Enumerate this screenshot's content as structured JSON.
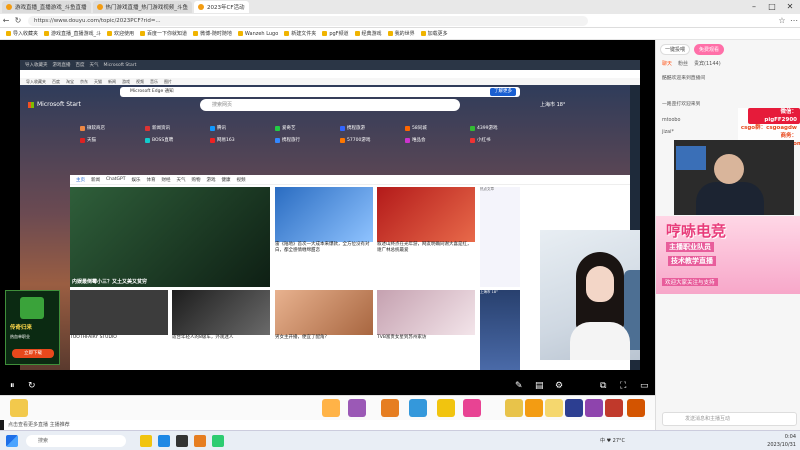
{
  "outer_tabs": [
    {
      "label": "游戏直播_直播游戏_斗鱼直播"
    },
    {
      "label": "热门游戏直播_热门游戏视频_斗鱼"
    },
    {
      "label": "2023年CF活动"
    }
  ],
  "address": {
    "url": "https://www.douyu.com/topic/2023PCF?rid=..."
  },
  "bookmarks": [
    "导入收藏夹",
    "游戏直播_直播游戏_斗",
    "欢迎使用",
    "百度一下你就知道",
    "微博-随时随地",
    "Wanzeh Lugo",
    "新建文件夹",
    "pgF频道",
    "经典游戏",
    "我的世界",
    "加载更多"
  ],
  "remote": {
    "tabs": [
      "导入收藏夹",
      "游戏直播",
      "百度",
      "天气",
      "Microsoft Start"
    ],
    "bookmarks": [
      "导入收藏夹",
      "百度",
      "淘宝",
      "京东",
      "天猫",
      "新闻",
      "游戏",
      "视频",
      "音乐",
      "图片"
    ],
    "notice": "Microsoft Edge 通知",
    "notice_btn": "了解更多",
    "ms_logo": "Microsoft Start",
    "search_placeholder": "搜索网页",
    "weather": "上海市  18°",
    "quick_links": [
      "微软商店",
      "新闻资讯",
      "腾讯",
      "爱奇艺",
      "携程旅游",
      "天猫",
      "BOSS直聘",
      "网易163",
      "携程旅行",
      "57700游戏",
      "58同城",
      "唯品会",
      "4399游戏",
      "小红书"
    ],
    "feed_tabs": [
      "主页",
      "新闻",
      "ChatGPT",
      "娱乐",
      "体育",
      "财经",
      "天气",
      "购物",
      "游戏",
      "健康",
      "视频"
    ],
    "cards": [
      {
        "caption": "内娱最倒霉小三？又土又美又贫穷"
      },
      {
        "title": "雷《陆地》首次一大成本来爆款，全方位没有对白，都全感情缠绵甜恋"
      },
      {
        "title": "叙述山终点在光年游，网友明确同谢大喜是红，谢广林总统最爱"
      },
      {
        "caption": "TOOTHFAIRY STUDIO"
      },
      {
        "title": "适合年轻人的8级车，外观迷人"
      },
      {
        "title": "男女主开播，便宜了配角？"
      },
      {
        "title": "TVB富贵女星到苏州家访"
      }
    ],
    "trending_title": "热点文章",
    "weather_card": "上海市 18°"
  },
  "left_ad": {
    "title": "传奇归来",
    "sub": "热血单职业",
    "cta": "立即下载"
  },
  "right_panel": {
    "pills": [
      "一键投喂",
      "免费观看"
    ],
    "tabs": [
      "聊天",
      "粉丝",
      "贵宾(1144)"
    ],
    "chat": [
      "酷酷欢迎来到直播间",
      "一路歪打欢迎来到",
      "mtoobo",
      "jizai*"
    ],
    "contact": [
      "微信：pigFF2900",
      "csgo群：csgoagdw",
      "商务：dai2hdp04@163.com"
    ],
    "brand": {
      "name": "哼哧电竞",
      "line1": "主播职业队员",
      "line2": "技术教学直播",
      "line3": "欢迎大家关注与支持"
    },
    "input_placeholder": "发送消息和主播互动"
  },
  "stream_notice": "点击查看更多直播 主播推荐",
  "taskbar": {
    "search": "搜索",
    "time": "0:04",
    "date": "2023/10/31",
    "tray": "中 ♥ 27°C"
  },
  "colors": {
    "accent": "#ff5a1f",
    "brand_pink": "#e83b7a",
    "ms_blue": "#1a5fd1"
  }
}
